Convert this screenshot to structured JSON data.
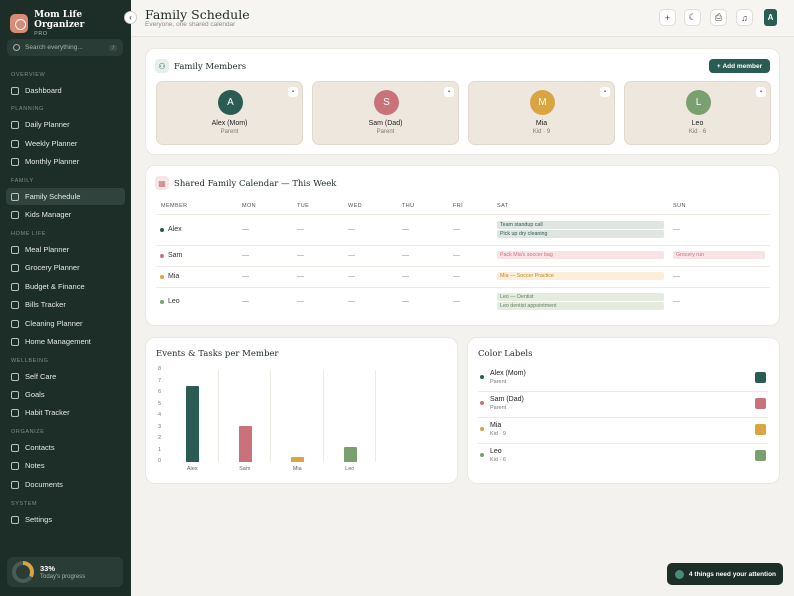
{
  "app": {
    "name": "Mom Life Organizer",
    "plan": "PRO"
  },
  "colors": {
    "sidebar": "#1d2e29",
    "accent": "#2a5c53",
    "alex": "#2a5c53",
    "sam": "#c9727a",
    "mia": "#d9a441",
    "leo": "#7aa06f"
  },
  "search": {
    "placeholder": "Search everything...",
    "shortcut": "/"
  },
  "sidebar": {
    "sections": {
      "overview": "OVERVIEW",
      "planning": "PLANNING",
      "family": "FAMILY",
      "home_life": "HOME LIFE",
      "wellbeing": "WELLBEING",
      "organize": "ORGANIZE",
      "system": "SYSTEM"
    },
    "items": [
      {
        "label": "Dashboard",
        "icon": "grid-icon"
      },
      {
        "label": "Daily Planner",
        "icon": "calendar-icon"
      },
      {
        "label": "Weekly Planner",
        "icon": "calendar-icon"
      },
      {
        "label": "Monthly Planner",
        "icon": "calendar-icon"
      },
      {
        "label": "Family Schedule",
        "icon": "users-icon"
      },
      {
        "label": "Kids Manager",
        "icon": "smile-icon"
      },
      {
        "label": "Meal Planner",
        "icon": "utensils-icon"
      },
      {
        "label": "Grocery Planner",
        "icon": "cart-icon"
      },
      {
        "label": "Budget & Finance",
        "icon": "wallet-icon"
      },
      {
        "label": "Bills Tracker",
        "icon": "receipt-icon"
      },
      {
        "label": "Cleaning Planner",
        "icon": "sparkle-icon"
      },
      {
        "label": "Home Management",
        "icon": "home-icon"
      },
      {
        "label": "Self Care",
        "icon": "heart-icon"
      },
      {
        "label": "Goals",
        "icon": "target-icon"
      },
      {
        "label": "Habit Tracker",
        "icon": "check-icon"
      },
      {
        "label": "Contacts",
        "icon": "contact-icon"
      },
      {
        "label": "Notes",
        "icon": "note-icon"
      },
      {
        "label": "Documents",
        "icon": "document-icon"
      },
      {
        "label": "Settings",
        "icon": "gear-icon"
      }
    ],
    "progress": {
      "percent": "33%",
      "label": "Today's progress",
      "value": 0.33
    }
  },
  "header": {
    "title": "Family Schedule",
    "subtitle": "Everyone, one shared calendar",
    "avatar": "A"
  },
  "members_card": {
    "title": "Family Members",
    "add_label": "Add member",
    "members": [
      {
        "initial": "A",
        "name": "Alex (Mom)",
        "role": "Parent",
        "color": "#2a5c53"
      },
      {
        "initial": "S",
        "name": "Sam (Dad)",
        "role": "Parent",
        "color": "#c9727a"
      },
      {
        "initial": "M",
        "name": "Mia",
        "role": "Kid · 9",
        "color": "#d9a441"
      },
      {
        "initial": "L",
        "name": "Leo",
        "role": "Kid · 6",
        "color": "#7aa06f"
      }
    ]
  },
  "calendar": {
    "title": "Shared Family Calendar — This Week",
    "columns": [
      "MEMBER",
      "MON",
      "TUE",
      "WED",
      "THU",
      "FRI",
      "SAT",
      "SUN"
    ],
    "empty": "—",
    "rows": [
      {
        "name": "Alex",
        "sat": [
          "Team standup call",
          "Pick up dry cleaning"
        ],
        "sun": []
      },
      {
        "name": "Sam",
        "sat": [
          "Pack Mia's soccer bag"
        ],
        "sun": [
          "Grocery run"
        ]
      },
      {
        "name": "Mia",
        "sat": [
          "Mia — Soccer Practice"
        ],
        "sun": []
      },
      {
        "name": "Leo",
        "sat": [
          "Leo — Dentist",
          "Leo dentist appointment"
        ],
        "sun": []
      }
    ]
  },
  "bar_card": {
    "title": "Events & Tasks per Member"
  },
  "chart_data": {
    "type": "bar",
    "title": "Events & Tasks per Member",
    "categories": [
      "Alex",
      "Sam",
      "Mia",
      "Leo"
    ],
    "values": [
      6.6,
      3.1,
      0.4,
      1.3
    ],
    "colors": [
      "#2a5c53",
      "#c9727a",
      "#d9a441",
      "#7aa06f"
    ],
    "ylim": [
      0,
      8
    ],
    "yticks": [
      "0",
      "1",
      "2",
      "3",
      "4",
      "5",
      "6",
      "7",
      "8"
    ],
    "xlabel": "",
    "ylabel": ""
  },
  "legend_card": {
    "title": "Color Labels",
    "items": [
      {
        "name": "Alex (Mom)",
        "role": "Parent",
        "color": "#2a5c53"
      },
      {
        "name": "Sam (Dad)",
        "role": "Parent",
        "color": "#c9727a"
      },
      {
        "name": "Mia",
        "role": "Kid · 9",
        "color": "#d9a441"
      },
      {
        "name": "Leo",
        "role": "Kid · 6",
        "color": "#7aa06f"
      }
    ]
  },
  "toast": {
    "text": "4 things need your attention"
  }
}
